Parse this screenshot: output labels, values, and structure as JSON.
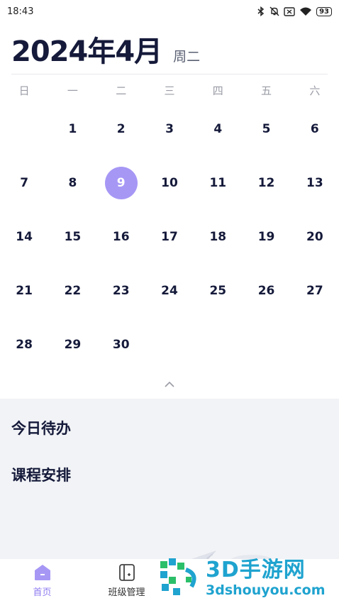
{
  "status_bar": {
    "time": "18:43",
    "battery": "93"
  },
  "header": {
    "title": "2024年4月",
    "weekday": "周二"
  },
  "week_days": [
    "日",
    "一",
    "二",
    "三",
    "四",
    "五",
    "六"
  ],
  "calendar": {
    "selected_day": "9",
    "weeks": [
      [
        "",
        "1",
        "2",
        "3",
        "4",
        "5",
        "6"
      ],
      [
        "7",
        "8",
        "9",
        "10",
        "11",
        "12",
        "13"
      ],
      [
        "14",
        "15",
        "16",
        "17",
        "18",
        "19",
        "20"
      ],
      [
        "21",
        "22",
        "23",
        "24",
        "25",
        "26",
        "27"
      ],
      [
        "28",
        "29",
        "30",
        "",
        "",
        "",
        ""
      ]
    ]
  },
  "sections": {
    "todo": "今日待办",
    "schedule": "课程安排"
  },
  "tabs": [
    {
      "label": "首页",
      "icon": "home-icon",
      "active": true
    },
    {
      "label": "班级管理",
      "icon": "class-icon",
      "active": false
    }
  ],
  "watermark": {
    "brand": "3D手游网",
    "url": "3dshouyou.com"
  },
  "colors": {
    "accent": "#a697f5",
    "tab_active": "#8f7cf0",
    "watermark": "#1fa3cf"
  }
}
